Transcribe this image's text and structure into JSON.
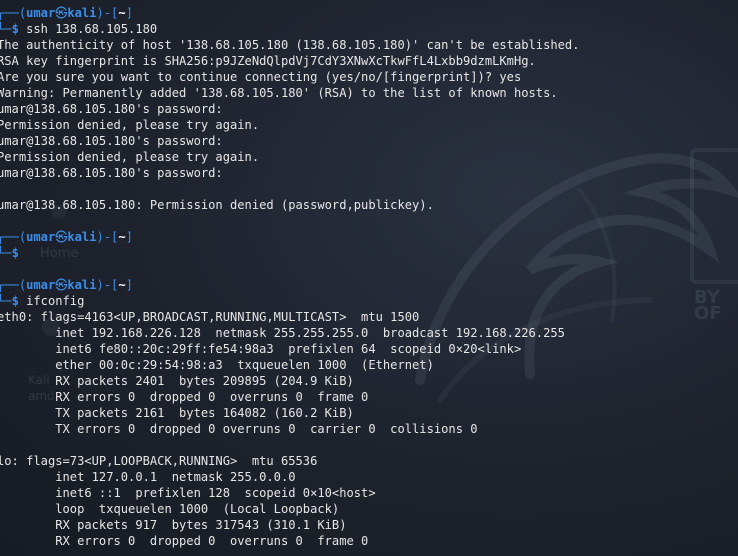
{
  "prompts": {
    "p1": {
      "user": "umar",
      "skull": "㉿",
      "host": "kali",
      "dir": "~",
      "command": "ssh 138.68.105.180"
    },
    "p2": {
      "user": "umar",
      "skull": "㉿",
      "host": "kali",
      "dir": "~",
      "command": ""
    },
    "p3": {
      "user": "umar",
      "skull": "㉿",
      "host": "kali",
      "dir": "~",
      "command": "ifconfig"
    }
  },
  "ssh_output": [
    "The authenticity of host '138.68.105.180 (138.68.105.180)' can't be established.",
    "RSA key fingerprint is SHA256:p9JZeNdQlpdVj7CdY3XNwXcTkwFfL4Lxbb9dzmLKmHg.",
    "Are you sure you want to continue connecting (yes/no/[fingerprint])? yes",
    "Warning: Permanently added '138.68.105.180' (RSA) to the list of known hosts.",
    "umar@138.68.105.180's password: ",
    "Permission denied, please try again.",
    "umar@138.68.105.180's password: ",
    "Permission denied, please try again.",
    "umar@138.68.105.180's password: ",
    "",
    "umar@138.68.105.180: Permission denied (password,publickey)."
  ],
  "ifconfig_output": [
    "eth0: flags=4163<UP,BROADCAST,RUNNING,MULTICAST>  mtu 1500",
    "        inet 192.168.226.128  netmask 255.255.255.0  broadcast 192.168.226.255",
    "        inet6 fe80::20c:29ff:fe54:98a3  prefixlen 64  scopeid 0×20<link>",
    "        ether 00:0c:29:54:98:a3  txqueuelen 1000  (Ethernet)",
    "        RX packets 2401  bytes 209895 (204.9 KiB)",
    "        RX errors 0  dropped 0  overruns 0  frame 0",
    "        TX packets 2161  bytes 164082 (160.2 KiB)",
    "        TX errors 0  dropped 0 overruns 0  carrier 0  collisions 0",
    "",
    "lo: flags=73<UP,LOOPBACK,RUNNING>  mtu 65536",
    "        inet 127.0.0.1  netmask 255.0.0.0",
    "        inet6 ::1  prefixlen 128  scopeid 0×10<host>",
    "        loop  txqueuelen 1000  (Local Loopback)",
    "        RX packets 917  bytes 317543 (310.1 KiB)",
    "        RX errors 0  dropped 0  overruns 0  frame 0"
  ],
  "wallpaper": {
    "home_label": "Home",
    "kali_label": "Kali",
    "amd_label": "amd",
    "byof_label": "BY OF"
  },
  "colors": {
    "prompt_blue": "#3b8eea",
    "text": "#e6e6e6",
    "background": "#1f2430"
  }
}
